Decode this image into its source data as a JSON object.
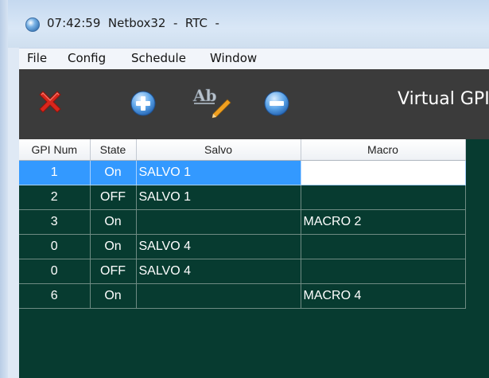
{
  "window": {
    "title": "07:42:59  Netbox32  -  RTC  -"
  },
  "menu": {
    "items": [
      {
        "label": "File"
      },
      {
        "label": "Config"
      },
      {
        "label": "Schedule"
      },
      {
        "label": "Window"
      }
    ]
  },
  "toolbar": {
    "title": "Virtual GPI",
    "icons": [
      "delete-x-icon",
      "add-plus-icon",
      "rename-ab-pencil-icon",
      "remove-minus-icon"
    ]
  },
  "table": {
    "columns": [
      "GPI Num",
      "State",
      "Salvo",
      "Macro"
    ],
    "rows": [
      {
        "gpi": "1",
        "state": "On",
        "salvo": "SALVO 1",
        "macro": ""
      },
      {
        "gpi": "2",
        "state": "OFF",
        "salvo": "SALVO 1",
        "macro": ""
      },
      {
        "gpi": "3",
        "state": "On",
        "salvo": "",
        "macro": "MACRO 2"
      },
      {
        "gpi": "0",
        "state": "On",
        "salvo": "SALVO 4",
        "macro": ""
      },
      {
        "gpi": "0",
        "state": "OFF",
        "salvo": "SALVO 4",
        "macro": ""
      },
      {
        "gpi": "6",
        "state": "On",
        "salvo": "",
        "macro": "MACRO 4"
      }
    ],
    "selected_row": 0
  },
  "colors": {
    "panel_bg": "#073b30",
    "toolbar_bg": "#3b3b3b",
    "selection": "#3399ff"
  }
}
